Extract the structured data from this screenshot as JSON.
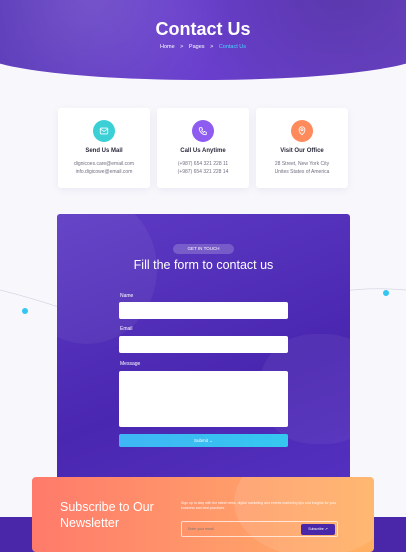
{
  "hero": {
    "title": "Contact Us",
    "breadcrumb": [
      "Home",
      ">",
      "Pages",
      ">",
      "Contact Us"
    ]
  },
  "info_cards": [
    {
      "icon": "envelope-icon",
      "title": "Send Us Mail",
      "lines": [
        "dignicoes.care@email.com",
        "info.digicowe@email.com"
      ],
      "color": "#3ad0d6"
    },
    {
      "icon": "phone-icon",
      "title": "Call Us Anytime",
      "lines": [
        "(+987) 654 321 228 11",
        "(+987) 654 321 228 14"
      ],
      "color": "#8e5cf0"
    },
    {
      "icon": "location-icon",
      "title": "Visit Our Office",
      "lines": [
        "28 Street, New York City",
        "Unites States of America"
      ],
      "color": "#ff8a5b"
    }
  ],
  "form": {
    "badge": "GET IN TOUCH",
    "title": "Fill the form to contact us",
    "name_label": "Name",
    "email_label": "Email",
    "message_label": "Message",
    "submit_label": "Submit"
  },
  "newsletter": {
    "title": "Subscribe to Our Newsletter",
    "text": "Sign up to stay with the latest news, digital marketing and events marketing tips and insights for your business and best practices.",
    "input_placeholder": "Enter your email",
    "button_label": "Subscribe"
  }
}
